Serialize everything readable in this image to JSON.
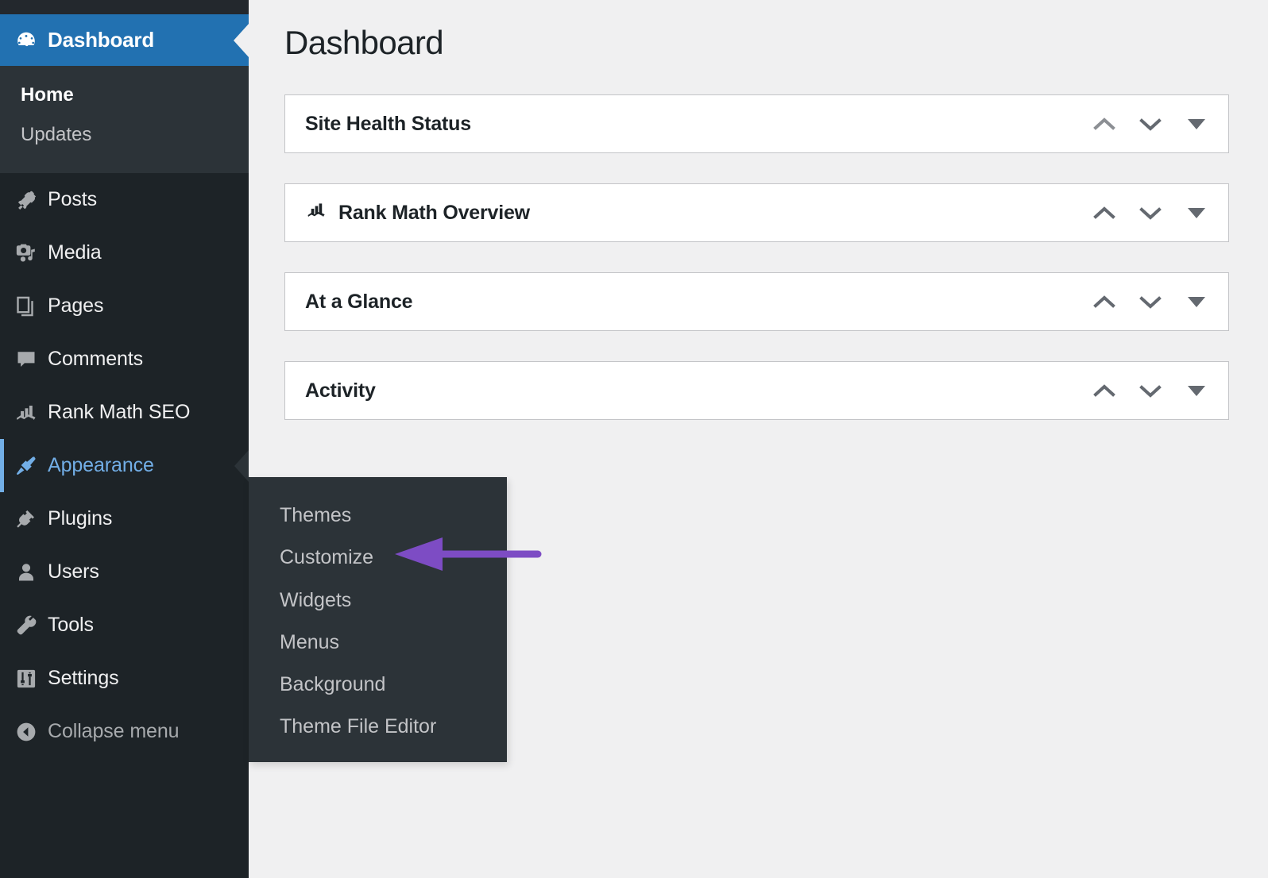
{
  "page": {
    "title": "Dashboard"
  },
  "sidebar": {
    "current": {
      "label": "Dashboard",
      "icon": "dashboard-gauge-icon",
      "submenu": [
        {
          "label": "Home",
          "current": true
        },
        {
          "label": "Updates",
          "current": false
        }
      ]
    },
    "items": [
      {
        "label": "Posts",
        "icon": "pushpin-icon",
        "state": "normal"
      },
      {
        "label": "Media",
        "icon": "camera-music-icon",
        "state": "normal"
      },
      {
        "label": "Pages",
        "icon": "pages-stack-icon",
        "state": "normal"
      },
      {
        "label": "Comments",
        "icon": "comment-bubble-icon",
        "state": "normal"
      },
      {
        "label": "Rank Math SEO",
        "icon": "bar-chart-arrow-icon",
        "state": "normal"
      },
      {
        "label": "Appearance",
        "icon": "paintbrush-icon",
        "state": "open"
      },
      {
        "label": "Plugins",
        "icon": "plug-icon",
        "state": "normal"
      },
      {
        "label": "Users",
        "icon": "user-icon",
        "state": "normal"
      },
      {
        "label": "Tools",
        "icon": "wrench-icon",
        "state": "normal"
      },
      {
        "label": "Settings",
        "icon": "sliders-icon",
        "state": "normal"
      },
      {
        "label": "Collapse menu",
        "icon": "collapse-arrow-icon",
        "state": "collapse"
      }
    ]
  },
  "flyout": {
    "parent": "Appearance",
    "items": [
      {
        "label": "Themes"
      },
      {
        "label": "Customize"
      },
      {
        "label": "Widgets"
      },
      {
        "label": "Menus"
      },
      {
        "label": "Background"
      },
      {
        "label": "Theme File Editor"
      }
    ]
  },
  "annotation": {
    "type": "arrow",
    "points_to": "Customize",
    "color": "#7d4cc4"
  },
  "panels": [
    {
      "title": "Site Health Status",
      "icon": null
    },
    {
      "title": "Rank Math Overview",
      "icon": "rank-math-icon"
    },
    {
      "title": "At a Glance",
      "icon": null
    },
    {
      "title": "Activity",
      "icon": null
    }
  ],
  "panel_controls": {
    "move_up": "move-up",
    "move_down": "move-down",
    "toggle": "toggle-panel"
  },
  "colors": {
    "sidebar_bg": "#1d2327",
    "sidebar_submenu_bg": "#2c3338",
    "accent_blue": "#2271b1",
    "link_blue": "#72aee6",
    "content_bg": "#f0f0f1",
    "annotation_purple": "#7d4cc4"
  }
}
